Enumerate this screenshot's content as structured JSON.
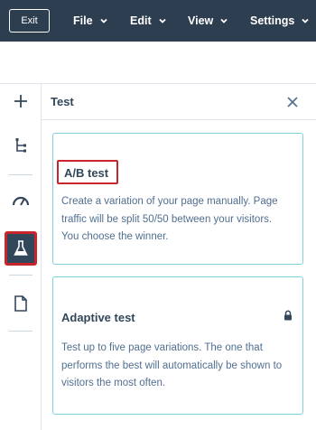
{
  "topbar": {
    "exit_label": "Exit",
    "menus": [
      {
        "label": "File"
      },
      {
        "label": "Edit"
      },
      {
        "label": "View"
      },
      {
        "label": "Settings"
      }
    ]
  },
  "sidebar": {
    "items": [
      {
        "icon": "plus-icon"
      },
      {
        "icon": "tree-structure-icon"
      },
      {
        "icon": "speedometer-icon"
      },
      {
        "icon": "beaker-icon",
        "active": true
      },
      {
        "icon": "document-icon"
      }
    ]
  },
  "panel": {
    "title": "Test",
    "close_icon": "close-icon",
    "cards": [
      {
        "title": "A/B test",
        "description_lines": [
          "Create a variation of your page manually. Page",
          "traffic will be split 50/50 between your visitors.",
          "You choose the winner."
        ]
      },
      {
        "title": "Adaptive test",
        "locked_icon": "lock-icon",
        "description_lines": [
          "Test up to five page variations. The one that",
          "performs the best will automatically be shown to",
          "visitors the most often."
        ]
      }
    ]
  },
  "colors": {
    "topbar_bg": "#2d3e50",
    "highlight_red": "#c9252d",
    "card_border": "#7fd1de",
    "text_dark": "#33475b",
    "text_body": "#516f90"
  }
}
